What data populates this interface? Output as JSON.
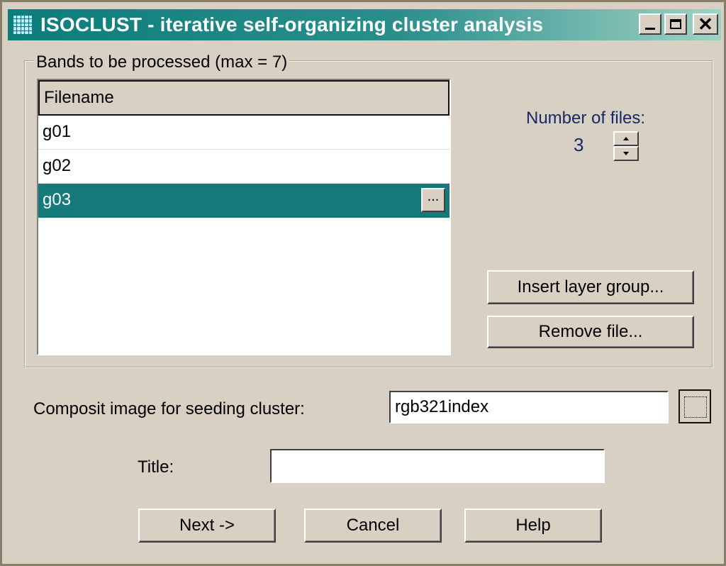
{
  "window": {
    "title": "ISOCLUST - iterative self-organizing cluster analysis",
    "minimize_glyph": "",
    "close_glyph": "✕"
  },
  "bands": {
    "legend": "Bands to be processed (max = 7)",
    "column_header": "Filename",
    "rows": [
      "g01",
      "g02",
      "g03"
    ],
    "selected_index": 2,
    "row_button_label": "..."
  },
  "number_of_files": {
    "label": "Number of files:",
    "value": "3"
  },
  "buttons": {
    "insert_layer_group": "Insert layer group...",
    "remove_file": "Remove file...",
    "next": "Next ->",
    "cancel": "Cancel",
    "help": "Help"
  },
  "seed": {
    "label": "Composit image for seeding cluster:",
    "value": "rgb321index"
  },
  "title_field": {
    "label": "Title:",
    "value": ""
  },
  "colors": {
    "titlebar": "#0b7d7b",
    "selection": "#167a7a",
    "face": "#d8d0c2",
    "label_blue": "#15296b"
  }
}
